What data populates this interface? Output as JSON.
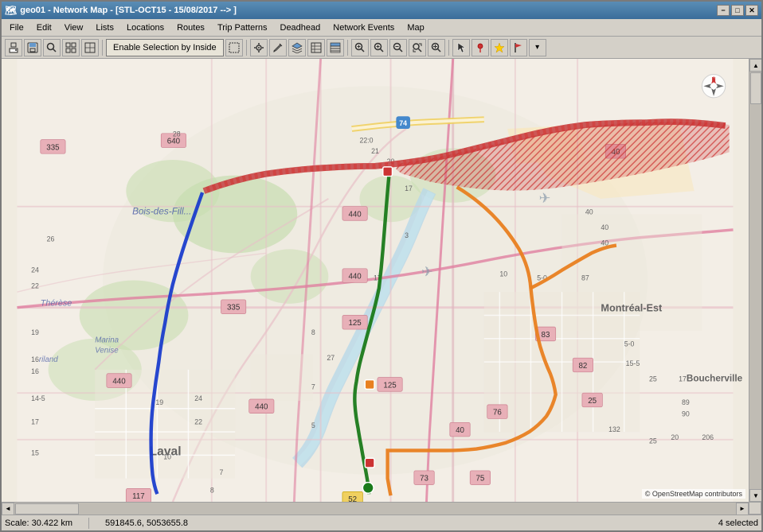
{
  "window": {
    "title": "geo01 - Network Map - [STL-OCT15 - 15/08/2017 --> ]",
    "min_btn": "−",
    "max_btn": "□",
    "close_btn": "✕"
  },
  "menu": {
    "items": [
      "File",
      "Edit",
      "View",
      "Lists",
      "Locations",
      "Routes",
      "Trip Patterns",
      "Deadhead",
      "Network Events",
      "Map"
    ]
  },
  "toolbar": {
    "enable_selection_label": "Enable Selection by Inside",
    "icons": [
      "print",
      "save",
      "search",
      "grid1",
      "grid2",
      "settings",
      "pencil",
      "layers",
      "table1",
      "table2",
      "zoom-in-rect",
      "zoom-in",
      "zoom-out",
      "zoom-fit",
      "zoom-move",
      "pointer",
      "pin",
      "star",
      "flag",
      "more"
    ]
  },
  "map": {
    "scale_label": "Scale: 30.422 km",
    "coords_label": "591845.6, 5053655.8",
    "selected_label": "4 selected",
    "osm_attribution": "© OpenStreetMap contributors",
    "scroll_up": "▲",
    "scroll_down": "▼",
    "scroll_left": "◄",
    "scroll_right": "►"
  },
  "colors": {
    "route_blue": "#1a3dcc",
    "route_green": "#1a7a1a",
    "route_orange": "#e88020",
    "route_red_hatched": "#cc3333",
    "road_pink": "#e8a0b0",
    "road_white": "#ffffff",
    "land_light": "#f5f0e8",
    "land_green": "#c8ddb0",
    "water": "#b8d8e8",
    "urban": "#e8e0d0"
  }
}
